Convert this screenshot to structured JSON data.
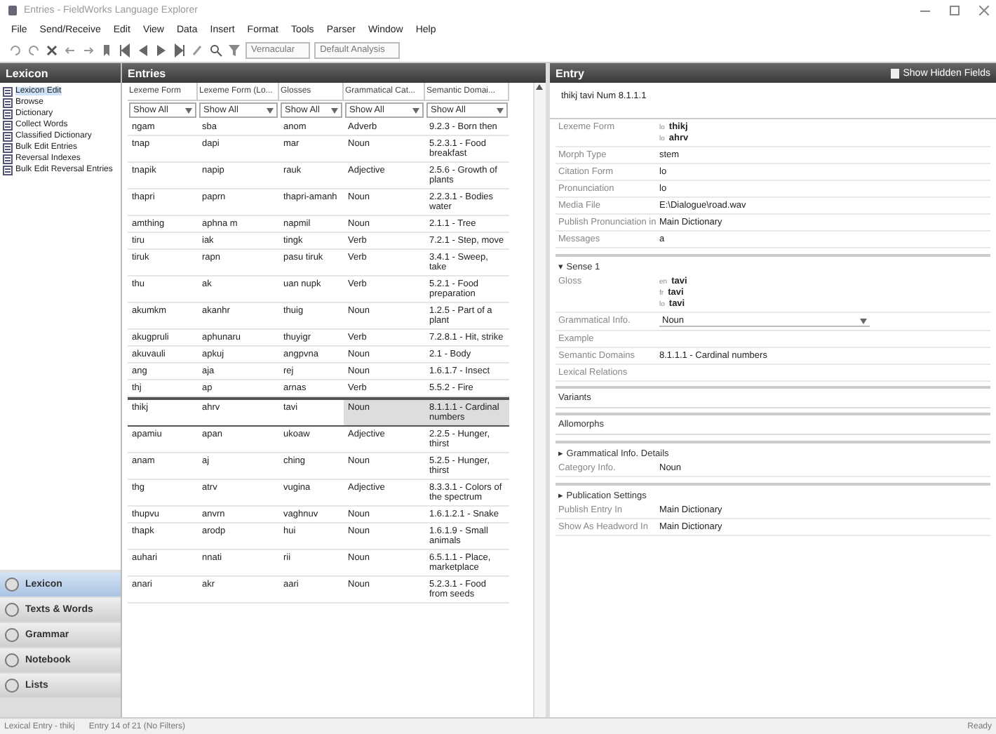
{
  "window": {
    "title": "Entries - FieldWorks Language Explorer"
  },
  "menu": [
    "File",
    "Send/Receive",
    "Edit",
    "View",
    "Data",
    "Insert",
    "Format",
    "Tools",
    "Parser",
    "Window",
    "Help"
  ],
  "toolbar": {
    "combos": [
      "Vernacular",
      "Default Analysis"
    ]
  },
  "sidebar": {
    "title": "Lexicon",
    "items": [
      {
        "label": "Lexicon Edit",
        "selected": true
      },
      {
        "label": "Browse",
        "selected": false
      },
      {
        "label": "Dictionary",
        "selected": false
      },
      {
        "label": "Collect Words",
        "selected": false
      },
      {
        "label": "Classified Dictionary",
        "selected": false
      },
      {
        "label": "Bulk Edit Entries",
        "selected": false
      },
      {
        "label": "Reversal Indexes",
        "selected": false
      },
      {
        "label": "Bulk Edit Reversal Entries",
        "selected": false
      }
    ],
    "areas": [
      {
        "label": "Lexicon",
        "selected": true
      },
      {
        "label": "Texts & Words",
        "selected": false
      },
      {
        "label": "Grammar",
        "selected": false
      },
      {
        "label": "Notebook",
        "selected": false
      },
      {
        "label": "Lists",
        "selected": false
      }
    ]
  },
  "browse": {
    "title": "Entries",
    "columns": [
      "Lexeme Form",
      "Lexeme Form (Lo...",
      "Glosses",
      "Grammatical Cat...",
      "Semantic Domai..."
    ],
    "filters": [
      "Show All",
      "Show All",
      "Show All",
      "Show All",
      "Show All"
    ],
    "rows": [
      {
        "cells": [
          "ngam",
          "sba",
          "anom",
          "Adverb",
          "9.2.3 - Born then"
        ],
        "selected": false
      },
      {
        "cells": [
          "tnap",
          "dapi",
          "mar",
          "Noun",
          "5.2.3.1 - Food breakfast"
        ],
        "selected": false
      },
      {
        "cells": [
          "tnapik",
          "napip",
          "rauk",
          "Adjective",
          "2.5.6 - Growth of plants"
        ],
        "selected": false
      },
      {
        "cells": [
          "thapri",
          "paprn",
          "thapri-amanh",
          "Noun",
          "2.2.3.1 - Bodies water"
        ],
        "selected": false
      },
      {
        "cells": [
          "amthing",
          "aphna m",
          "napmil",
          "Noun",
          "2.1.1 - Tree"
        ],
        "selected": false
      },
      {
        "cells": [
          "tiru",
          "iak",
          "tingk",
          "Verb",
          "7.2.1 - Step, move"
        ],
        "selected": false
      },
      {
        "cells": [
          "tiruk",
          "rapn",
          "pasu tiruk",
          "Verb",
          "3.4.1 - Sweep, take"
        ],
        "selected": false
      },
      {
        "cells": [
          "thu",
          "ak",
          "uan nupk",
          "Verb",
          "5.2.1 - Food preparation"
        ],
        "selected": false
      },
      {
        "cells": [
          "akumkm",
          "akanhr",
          "thuig",
          "Noun",
          "1.2.5 - Part of a plant"
        ],
        "selected": false
      },
      {
        "cells": [
          "akugpruli",
          "aphunaru",
          "thuyigr",
          "Verb",
          "7.2.8.1 - Hit, strike"
        ],
        "selected": false
      },
      {
        "cells": [
          "akuvauli",
          "apkuj",
          "angpvna",
          "Noun",
          "2.1 - Body"
        ],
        "selected": false
      },
      {
        "cells": [
          "ang",
          "aja",
          "rej",
          "Noun",
          "1.6.1.7 - Insect"
        ],
        "selected": false
      },
      {
        "cells": [
          "thj",
          "ap",
          "arnas",
          "Verb",
          "5.5.2 - Fire"
        ],
        "selected": false
      },
      {
        "cells": [
          "thikj",
          "ahrv",
          "tavi",
          "Noun",
          "8.1.1.1 - Cardinal numbers"
        ],
        "selected": true
      },
      {
        "cells": [
          "apamiu",
          "apan",
          "ukoaw",
          "Adjective",
          "2.2.5 - Hunger, thirst"
        ],
        "selected": false
      },
      {
        "cells": [
          "anam",
          "aj",
          "ching",
          "Noun",
          "5.2.5 - Hunger, thirst"
        ],
        "selected": false
      },
      {
        "cells": [
          "thg",
          "atrv",
          "vugina",
          "Adjective",
          "8.3.3.1 - Colors of the spectrum"
        ],
        "selected": false
      },
      {
        "cells": [
          "thupvu",
          "anvrn",
          "vaghnuv",
          "Noun",
          "1.6.1.2.1 - Snake"
        ],
        "selected": false
      },
      {
        "cells": [
          "thapk",
          "arodp",
          "hui",
          "Noun",
          "1.6.1.9 - Small animals"
        ],
        "selected": false
      },
      {
        "cells": [
          "auhari",
          "nnati",
          "rii",
          "Noun",
          "6.5.1.1 - Place, marketplace"
        ],
        "selected": false
      },
      {
        "cells": [
          "anari",
          "akr",
          "aari",
          "Noun",
          "5.2.3.1 - Food from seeds"
        ],
        "selected": false
      }
    ]
  },
  "entry": {
    "title": "Entry",
    "hidden_fields": "Show Hidden Fields",
    "headword": "thikj  tavi  Num  8.1.1.1",
    "fields": [
      {
        "kind": "multi",
        "label": "Lexeme Form",
        "values": [
          {
            "ws": "lo",
            "value": "thikj"
          },
          {
            "ws": "lo",
            "value": "ahrv"
          }
        ]
      },
      {
        "kind": "field",
        "label": "Morph Type",
        "value": "stem"
      },
      {
        "kind": "field",
        "label": "Citation Form",
        "value": "lo"
      },
      {
        "kind": "field",
        "label": "Pronunciation",
        "value": "lo"
      },
      {
        "kind": "field",
        "label": "Media File",
        "value": "E:\\Dialogue\\road.wav"
      },
      {
        "kind": "field",
        "label": "Publish Pronunciation in",
        "value": "Main Dictionary"
      },
      {
        "kind": "field",
        "label": "Messages",
        "value": "a"
      },
      {
        "kind": "section",
        "label": "▾ Sense 1"
      },
      {
        "kind": "multi",
        "label": "Gloss",
        "values": [
          {
            "ws": "en",
            "value": "tavi"
          },
          {
            "ws": "fr",
            "value": "tavi"
          },
          {
            "ws": "lo",
            "value": "tavi"
          }
        ]
      },
      {
        "kind": "dropdown",
        "label": "Grammatical Info.",
        "value": "Noun"
      },
      {
        "kind": "field",
        "label": "Example"
      },
      {
        "kind": "field",
        "label": "Semantic Domains",
        "value": "8.1.1.1 - Cardinal numbers"
      },
      {
        "kind": "field",
        "label": "Lexical Relations"
      },
      {
        "kind": "bar",
        "label": "Variants"
      },
      {
        "kind": "bar",
        "label": "Allomorphs"
      },
      {
        "kind": "section",
        "label": "▸ Grammatical Info. Details"
      },
      {
        "kind": "field",
        "label": "Category Info.",
        "value": "Noun"
      },
      {
        "kind": "section",
        "label": "▸ Publication Settings"
      },
      {
        "kind": "field",
        "label": "Publish Entry In",
        "value": "Main Dictionary"
      },
      {
        "kind": "field",
        "label": "Show As Headword In",
        "value": "Main Dictionary"
      }
    ]
  },
  "status_bar": {
    "left": "Lexical Entry - thikj",
    "middle": "Entry 14 of 21 (No Filters)",
    "right": "Ready"
  }
}
